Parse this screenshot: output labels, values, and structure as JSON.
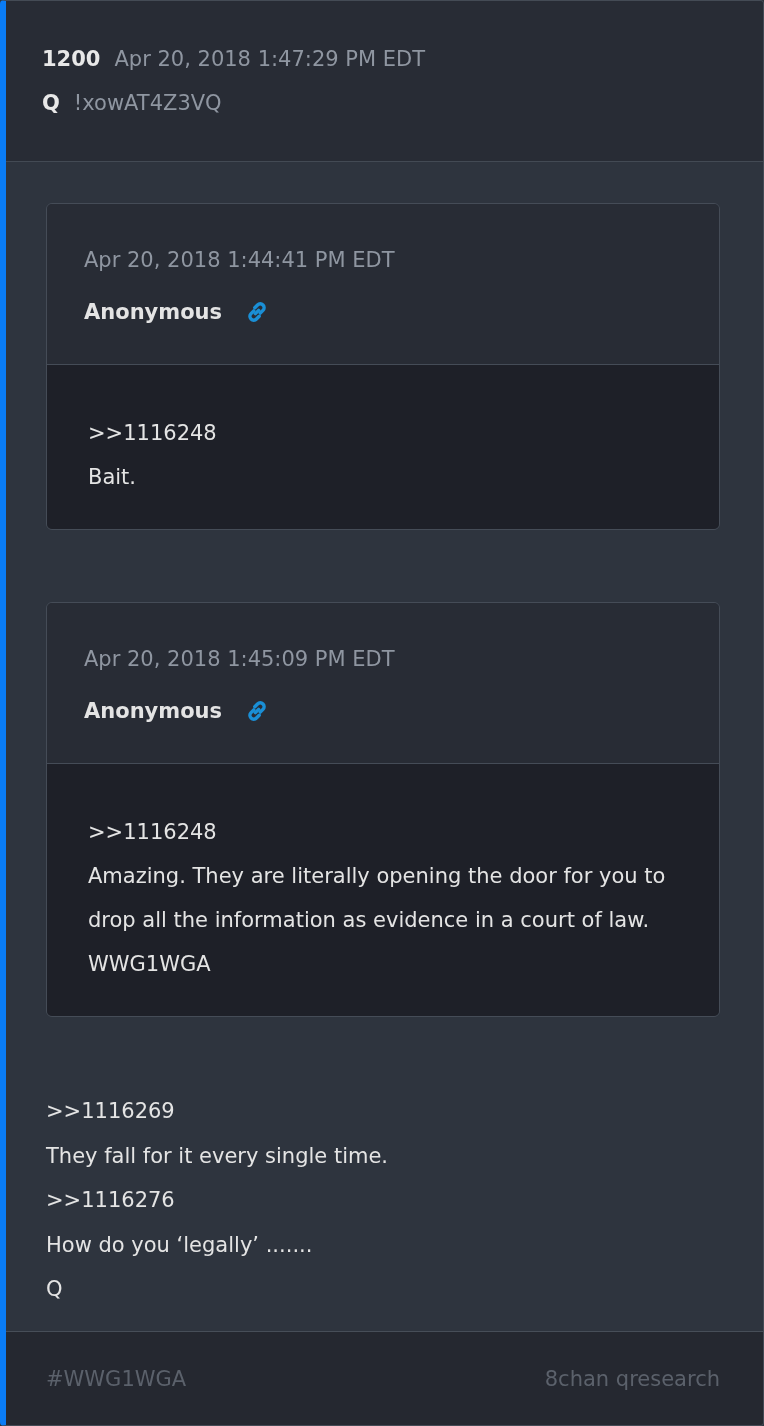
{
  "post": {
    "number": "1200",
    "timestamp": "Apr 20, 2018 1:47:29 PM EDT",
    "author": "Q",
    "tripcode": "!xowAT4Z3VQ"
  },
  "quotes": [
    {
      "timestamp": "Apr 20, 2018 1:44:41 PM EDT",
      "author": "Anonymous",
      "lines": [
        ">>1116248",
        "Bait."
      ]
    },
    {
      "timestamp": "Apr 20, 2018 1:45:09 PM EDT",
      "author": "Anonymous",
      "lines": [
        ">>1116248",
        "Amazing. They are literally opening the door for you to drop all the information as evidence in a court of law.",
        "WWG1WGA"
      ]
    }
  ],
  "body": [
    ">>1116269",
    "They fall for it every single time.",
    ">>1116276",
    "How do you ‘legally’ .......",
    "Q"
  ],
  "footer": {
    "tag": "#WWG1WGA",
    "source": "8chan qresearch"
  }
}
